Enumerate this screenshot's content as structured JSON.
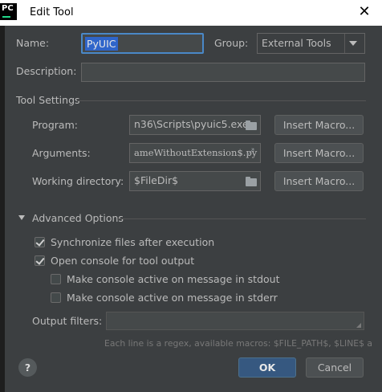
{
  "window": {
    "title": "Edit Tool",
    "close_glyph": "✕",
    "app_icon_text": "PC"
  },
  "form": {
    "name_label": "Name:",
    "name_value": "PyUIC",
    "group_label": "Group:",
    "group_value": "External Tools",
    "description_label": "Description:",
    "description_value": ""
  },
  "tool_settings": {
    "title": "Tool Settings",
    "program_label": "Program:",
    "program_value": "n36\\Scripts\\pyuic5.exe",
    "arguments_label": "Arguments:",
    "arguments_value": "ameWithoutExtension$.py",
    "workdir_label": "Working directory:",
    "workdir_value": "$FileDir$",
    "insert_macro_label": "Insert Macro..."
  },
  "advanced": {
    "title": "Advanced Options",
    "sync_label": "Synchronize files after execution",
    "sync_checked": true,
    "console_label": "Open console for tool output",
    "console_checked": true,
    "stdout_label": "Make console active on message in stdout",
    "stdout_checked": false,
    "stderr_label": "Make console active on message in stderr",
    "stderr_checked": false,
    "filters_label": "Output filters:",
    "filters_value": "",
    "hint": "Each line is a regex, available macros: $FILE_PATH$, $LINE$ a"
  },
  "footer": {
    "help_glyph": "?",
    "ok_label": "OK",
    "cancel_label": "Cancel"
  },
  "colors": {
    "accent": "#4a88c7",
    "background": "#3c3f41",
    "ok_button": "#365880"
  }
}
